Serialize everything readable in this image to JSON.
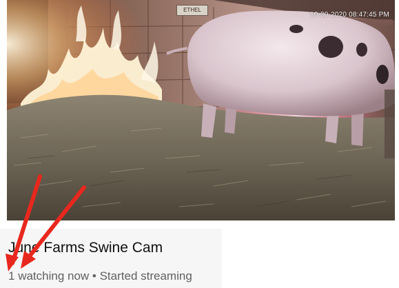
{
  "video": {
    "timestamp": "10-30-2020 08:47:45 PM",
    "barn_sign": "ETHEL"
  },
  "stream": {
    "title": "June Farms Swine Cam",
    "viewers": "1",
    "status_text": " watching now • Started streaming"
  },
  "annotation": {
    "arrow_color": "#e8281e"
  }
}
